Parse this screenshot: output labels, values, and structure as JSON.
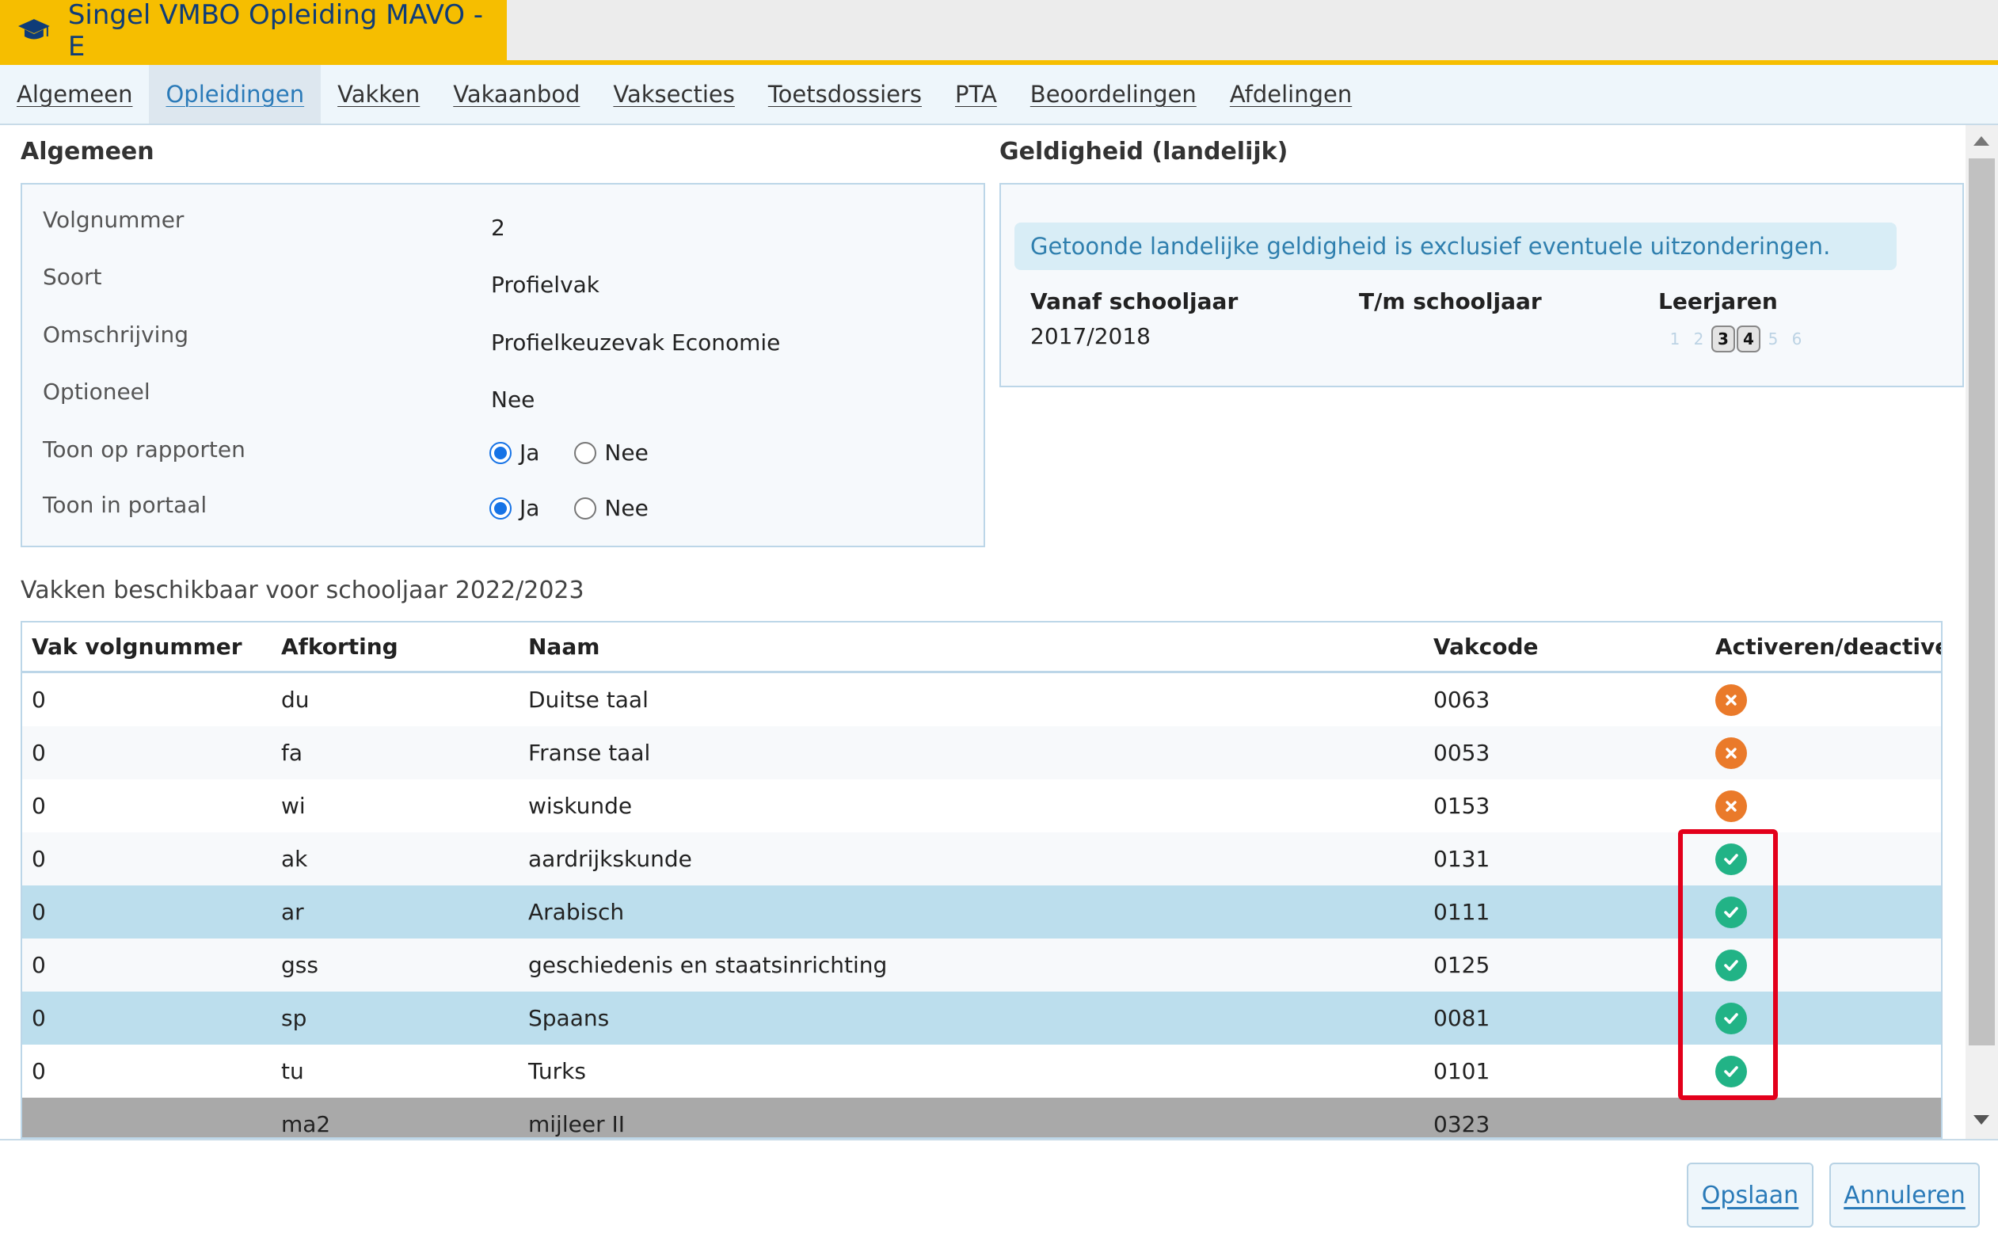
{
  "window": {
    "title": "Singel VMBO Opleiding MAVO - E",
    "icon": "graduation-cap-icon",
    "accent_color": "#f6be00"
  },
  "tabs": [
    {
      "label": "Algemeen",
      "active": false
    },
    {
      "label": "Opleidingen",
      "active": true
    },
    {
      "label": "Vakken",
      "active": false
    },
    {
      "label": "Vakaanbod",
      "active": false
    },
    {
      "label": "Vaksecties",
      "active": false
    },
    {
      "label": "Toetsdossiers",
      "active": false
    },
    {
      "label": "PTA",
      "active": false
    },
    {
      "label": "Beoordelingen",
      "active": false
    },
    {
      "label": "Afdelingen",
      "active": false
    }
  ],
  "algemeen": {
    "title": "Algemeen",
    "fields": [
      {
        "label": "Volgnummer",
        "value": "2"
      },
      {
        "label": "Soort",
        "value": "Profielvak"
      },
      {
        "label": "Omschrijving",
        "value": "Profielkeuzevak Economie"
      },
      {
        "label": "Optioneel",
        "value": "Nee"
      }
    ],
    "radios": [
      {
        "label": "Toon op rapporten",
        "yes": "Ja",
        "no": "Nee",
        "selected": "Ja"
      },
      {
        "label": "Toon in portaal",
        "yes": "Ja",
        "no": "Nee",
        "selected": "Ja"
      }
    ]
  },
  "geldigheid": {
    "title": "Geldigheid (landelijk)",
    "info": "Getoonde landelijke geldigheid is exclusief eventuele uitzonderingen.",
    "headers": {
      "vanaf": "Vanaf schooljaar",
      "tm": "T/m schooljaar",
      "leerjaren": "Leerjaren"
    },
    "vanaf_value": "2017/2018",
    "tm_value": "",
    "leerjaren": [
      {
        "n": "1",
        "on": false
      },
      {
        "n": "2",
        "on": false
      },
      {
        "n": "3",
        "on": true
      },
      {
        "n": "4",
        "on": true
      },
      {
        "n": "5",
        "on": false
      },
      {
        "n": "6",
        "on": false
      }
    ]
  },
  "vakken": {
    "title": "Vakken beschikbaar voor schooljaar 2022/2023",
    "columns": [
      "Vak volgnummer",
      "Afkorting",
      "Naam",
      "Vakcode",
      "Activeren/deactiveren"
    ],
    "rows": [
      {
        "nr": "0",
        "afk": "du",
        "naam": "Duitse taal",
        "code": "0063",
        "status": "deactivate"
      },
      {
        "nr": "0",
        "afk": "fa",
        "naam": "Franse taal",
        "code": "0053",
        "status": "deactivate"
      },
      {
        "nr": "0",
        "afk": "wi",
        "naam": "wiskunde",
        "code": "0153",
        "status": "deactivate"
      },
      {
        "nr": "0",
        "afk": "ak",
        "naam": "aardrijkskunde",
        "code": "0131",
        "status": "activate"
      },
      {
        "nr": "0",
        "afk": "ar",
        "naam": "Arabisch",
        "code": "0111",
        "status": "activate"
      },
      {
        "nr": "0",
        "afk": "gss",
        "naam": "geschiedenis en staatsinrichting",
        "code": "0125",
        "status": "activate"
      },
      {
        "nr": "0",
        "afk": "sp",
        "naam": "Spaans",
        "code": "0081",
        "status": "activate"
      },
      {
        "nr": "0",
        "afk": "tu",
        "naam": "Turks",
        "code": "0101",
        "status": "activate"
      },
      {
        "nr": "",
        "afk": "ma2",
        "naam": "mijleer II",
        "code": "0323",
        "status": "none"
      }
    ],
    "colors": {
      "activate": "#22b386",
      "deactivate": "#ea7a2a",
      "selected_row": "#bcdeed"
    }
  },
  "footer": {
    "save_label": "Opslaan",
    "cancel_label": "Annuleren"
  }
}
